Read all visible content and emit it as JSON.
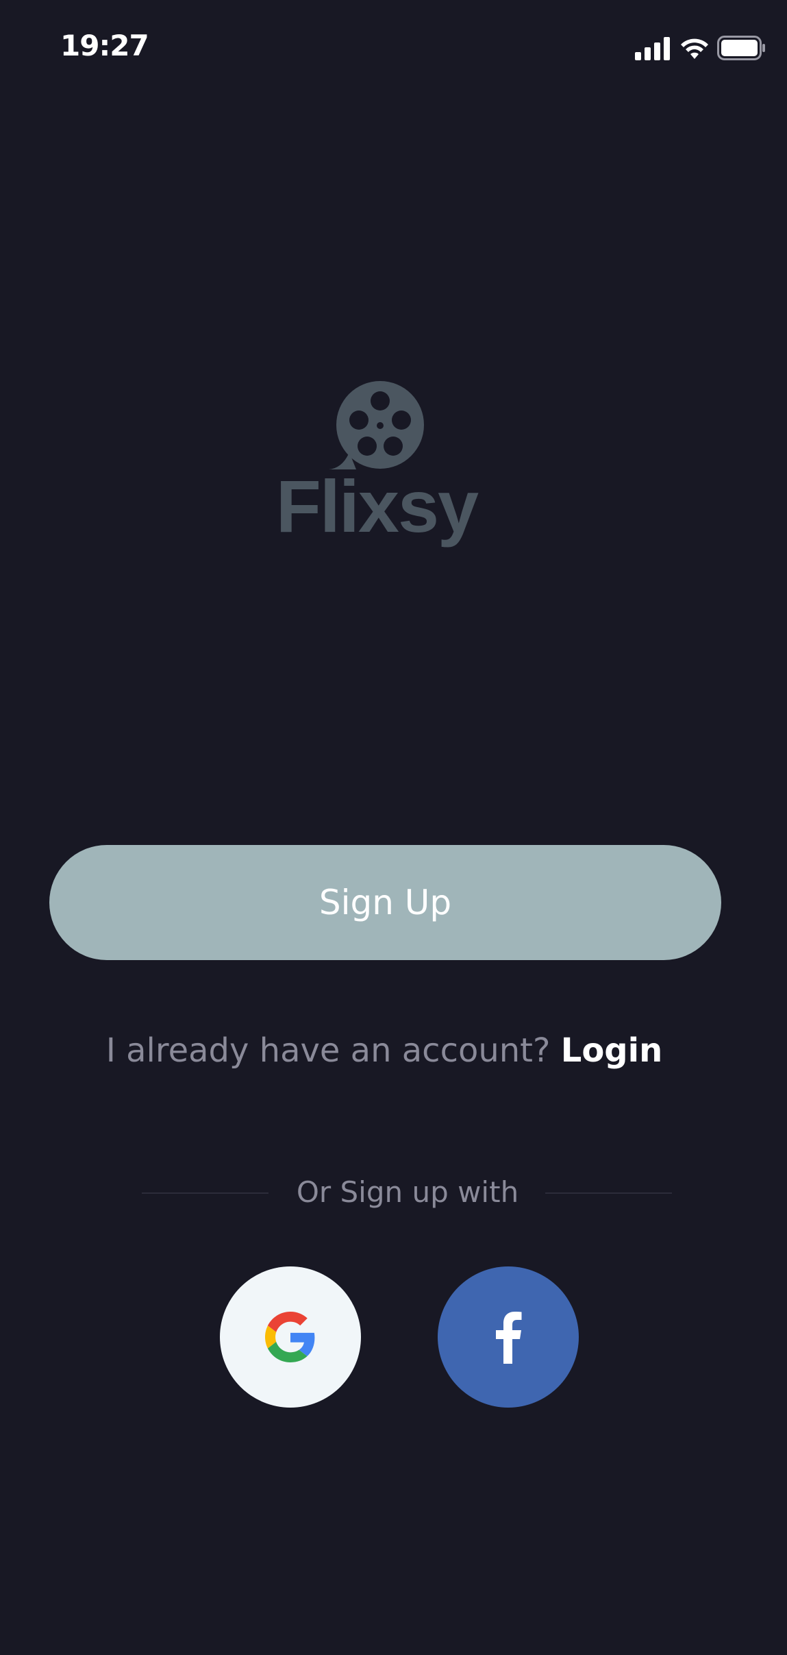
{
  "status_bar": {
    "time": "19:27",
    "icons": [
      "signal-icon",
      "wifi-icon",
      "battery-icon"
    ]
  },
  "logo": {
    "icon": "film-reel-icon",
    "wordmark": "Flixsy",
    "color": "#4b5660"
  },
  "actions": {
    "signup_label": "Sign Up",
    "signup_color": "#a0b5b9",
    "has_account_text": "I already have an account?",
    "login_label": "Login"
  },
  "social": {
    "divider_text": "Or Sign up with",
    "google_icon": "google-icon",
    "facebook_icon": "facebook-icon",
    "facebook_color": "#3f66b0"
  },
  "theme": {
    "background": "#181824"
  }
}
